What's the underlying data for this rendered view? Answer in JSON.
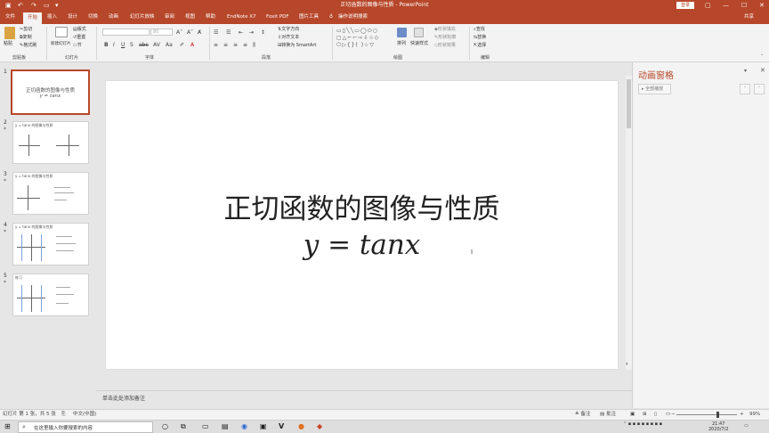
{
  "window": {
    "title": "正切函数的图像与性质  -  PowerPoint",
    "login_label": "登录",
    "min_icon": "minimize-icon",
    "max_icon": "maximize-icon",
    "close_icon": "close-icon"
  },
  "quick_access": {
    "save_icon": "save-icon",
    "undo_icon": "undo-icon",
    "redo_icon": "redo-icon",
    "present_icon": "present-from-start-icon",
    "more_icon": "customize-toolbar-icon"
  },
  "tabs": [
    "文件",
    "开始",
    "插入",
    "设计",
    "切换",
    "动画",
    "幻灯片放映",
    "审阅",
    "视图",
    "帮助",
    "EndNote X7",
    "Foxit PDF",
    "图片工具",
    "操作说明搜索"
  ],
  "tab_active": "开始",
  "tab_right": "共享",
  "ribbon": {
    "clipboard": {
      "label": "剪贴板",
      "paste": "粘贴",
      "cut": "剪切",
      "copy": "复制",
      "format_painter": "格式刷"
    },
    "slides": {
      "label": "幻灯片",
      "new_slide": "新建幻灯片",
      "layout": "版式",
      "reset": "重置",
      "section": "节"
    },
    "font": {
      "label": "字体",
      "font_name": "",
      "font_size": "80"
    },
    "paragraph": {
      "label": "段落",
      "text_direction": "文字方向",
      "align_text": "对齐文本",
      "smartart": "转换为 SmartArt"
    },
    "drawing": {
      "label": "绘图",
      "arrange": "排列",
      "quick_styles": "快速样式",
      "shape_fill": "形状填充",
      "shape_outline": "形状轮廓",
      "shape_effects": "形状效果"
    },
    "editing": {
      "label": "编辑",
      "find": "查找",
      "replace": "替换",
      "select": "选择"
    }
  },
  "thumbnails": [
    {
      "num": "1",
      "title": "正切函数的图像与性质",
      "subtitle": "y = tanx"
    },
    {
      "num": "2",
      "title": "y = tanx 的图像与性质"
    },
    {
      "num": "3",
      "title": "y = tanx 的图像与性质"
    },
    {
      "num": "4",
      "title": "y = tanx 的图像与性质"
    },
    {
      "num": "5",
      "title": "练习"
    }
  ],
  "slide": {
    "title": "正切函数的图像与性质",
    "formula": "y = tanx"
  },
  "notes_placeholder": "单击此处添加备注",
  "animation_pane": {
    "title": "动画窗格",
    "play_all": "全部播放"
  },
  "status": {
    "slide_info": "幻灯片 第 1 张，共 5 张",
    "language": "中文(中国)",
    "notes": "备注",
    "comments": "批注",
    "zoom": "99%"
  },
  "taskbar": {
    "search_placeholder": "在这里输入你要搜索的内容",
    "time": "21:47",
    "date": "2020/7/2"
  }
}
